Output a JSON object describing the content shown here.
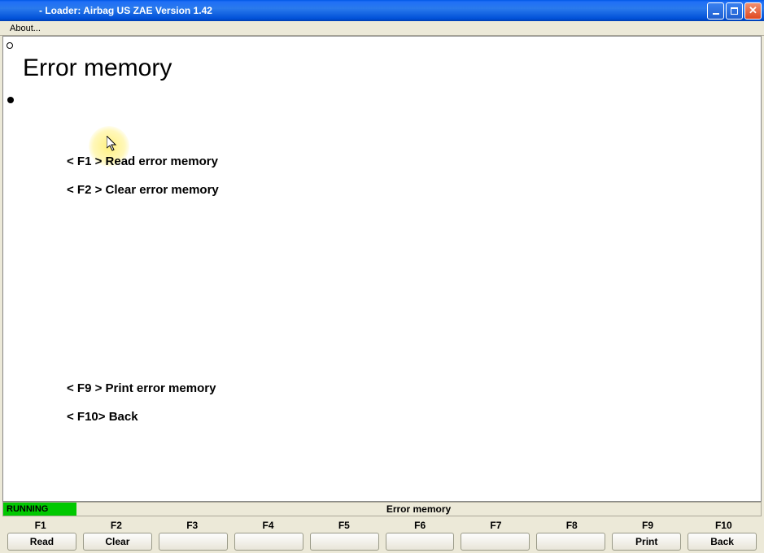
{
  "titlebar": {
    "text": "       - Loader:   Airbag US ZAE Version 1.42"
  },
  "menubar": {
    "about": "About..."
  },
  "page": {
    "title": "Error memory"
  },
  "menu": {
    "f1": "< F1 >  Read error memory",
    "f2": "< F2 >  Clear error memory",
    "f9": "< F9 >  Print error memory",
    "f10": "< F10>  Back"
  },
  "status": {
    "running": "RUNNING",
    "title": "Error memory"
  },
  "fkeys": {
    "labels": [
      "F1",
      "F2",
      "F3",
      "F4",
      "F5",
      "F6",
      "F7",
      "F8",
      "F9",
      "F10"
    ],
    "buttons": [
      "Read",
      "Clear",
      "",
      "",
      "",
      "",
      "",
      "",
      "Print",
      "Back"
    ]
  }
}
